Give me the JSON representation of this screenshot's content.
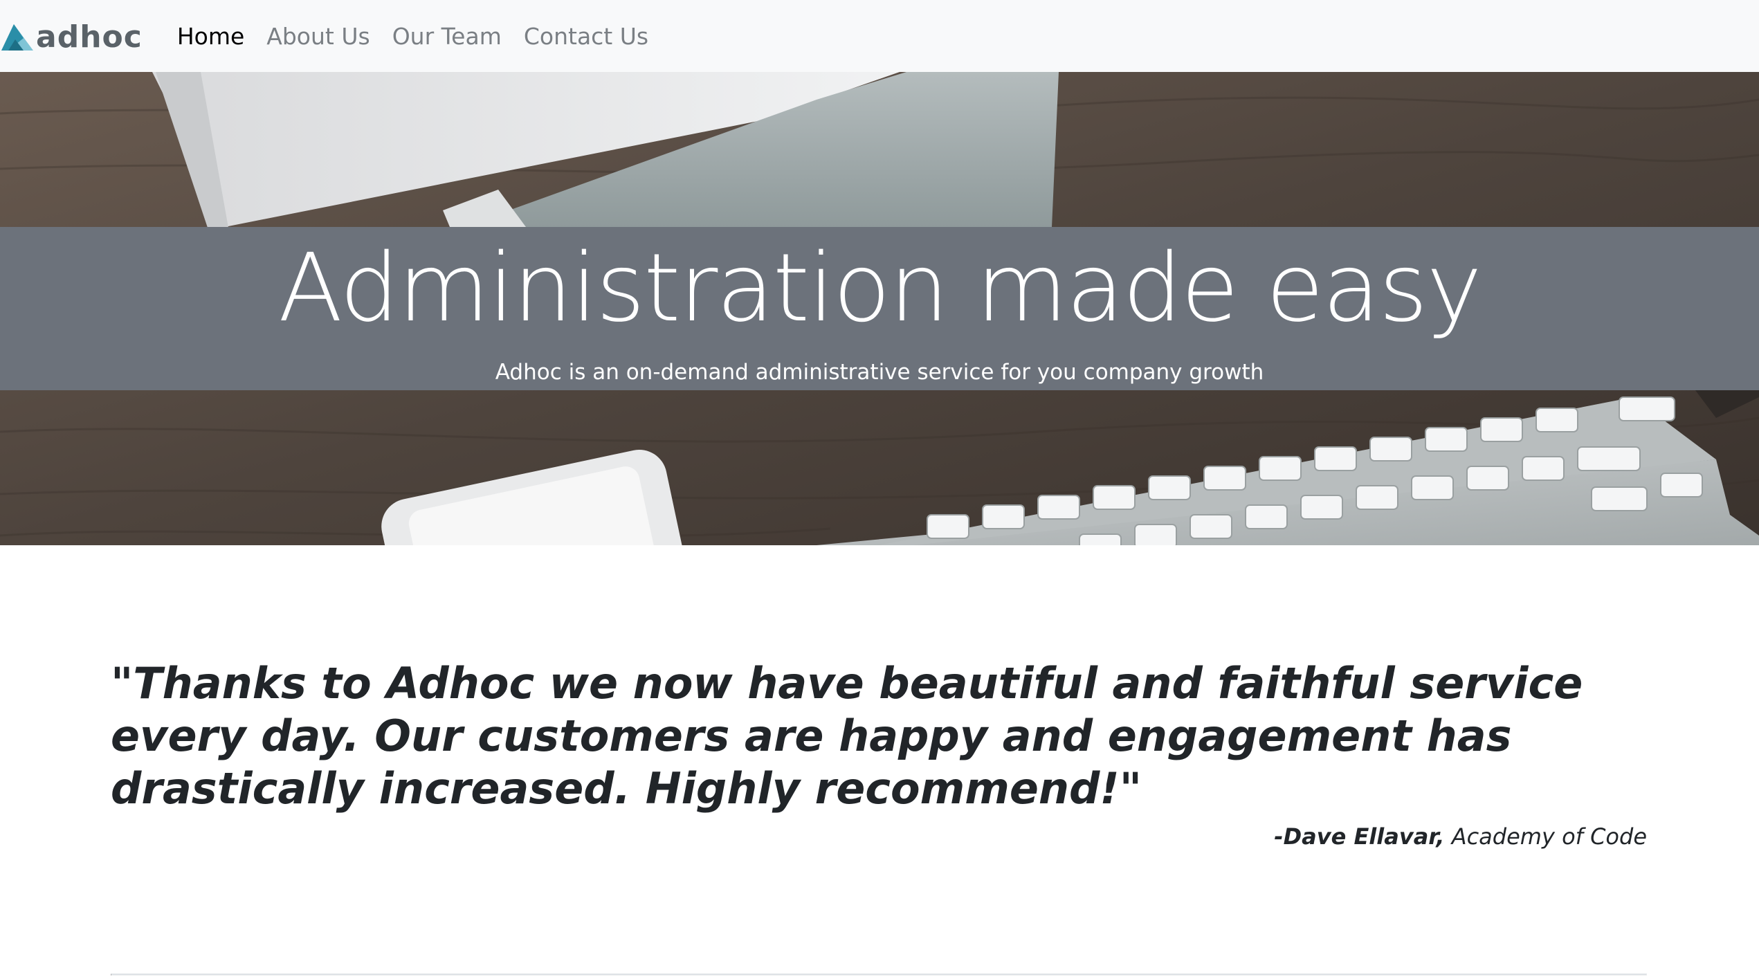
{
  "brand": {
    "name": "adhoc",
    "mark_color_left": "#2a8ea8",
    "mark_color_right": "#7fc4d6"
  },
  "nav": {
    "items": [
      {
        "label": "Home",
        "active": true
      },
      {
        "label": "About Us",
        "active": false
      },
      {
        "label": "Our Team",
        "active": false
      },
      {
        "label": "Contact Us",
        "active": false
      }
    ]
  },
  "hero": {
    "title": "Administration made easy",
    "subtitle": "Adhoc is an on-demand administrative service for you company growth",
    "band_color": "#6c727b",
    "background": "desk-with-monitor-and-keyboard-photo"
  },
  "testimonial": {
    "quote": "\"Thanks to Adhoc we now have beautiful and faithful service every day. Our customers are happy and engagement has drastically increased. Highly recommend!\"",
    "author": "-Dave Ellavar,",
    "company": "Academy of Code"
  },
  "colors": {
    "navbar_bg": "#f8f9fa",
    "nav_active": "#000000",
    "nav_inactive": "#7a7f84",
    "text": "#212529"
  }
}
